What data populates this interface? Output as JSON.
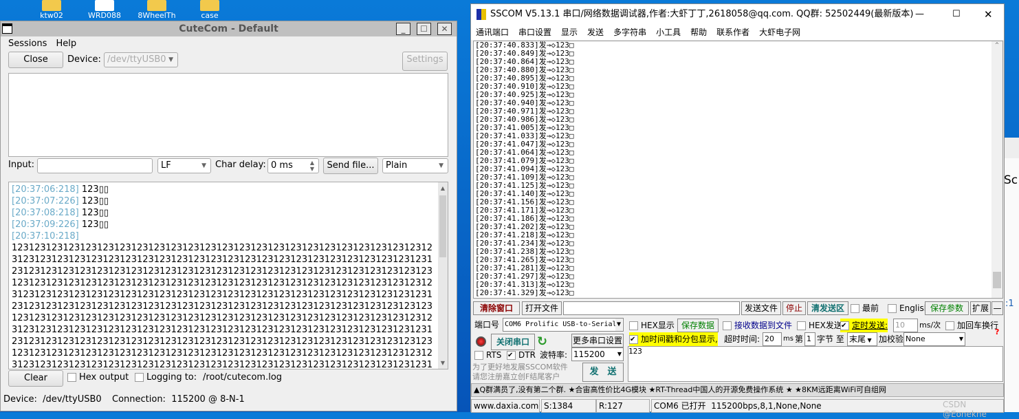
{
  "desktop": {
    "icons": [
      "ktw02",
      "WRD088",
      "8WheelTh",
      "case"
    ],
    "right_app_text": "Sc",
    "right_app_text2": ":1"
  },
  "cutecom": {
    "title": "CuteCom - Default",
    "menu": [
      "Sessions",
      "Help"
    ],
    "close_label": "Close",
    "device_label": "Device:",
    "device_value": "/dev/ttyUSB0",
    "settings_label": "Settings",
    "input_label": "Input:",
    "input_value": "",
    "line_end": "LF",
    "char_delay_label": "Char delay:",
    "char_delay_value": "0 ms",
    "send_file_label": "Send file...",
    "format": "Plain",
    "log": [
      {
        "ts": "[20:37:06:218]",
        "text": "123▯▯"
      },
      {
        "ts": "[20:37:07:226]",
        "text": "123▯▯"
      },
      {
        "ts": "[20:37:08:218]",
        "text": "123▯▯"
      },
      {
        "ts": "[20:37:09:226]",
        "text": "123▯▯"
      },
      {
        "ts": "[20:37:10:218]",
        "text": ""
      }
    ],
    "stream": "123123123123123123123123123123123123123123123123123123123123123123123123123123123123123123123123123123123123123123123123123123123123123123123123123123123123123123123123123123123123123123123123123123123123123123123123123123123123123123123123123123123123123123123123123123123123123123123123123123123123123123123123123123123123123123123123123123123123123123123123123123123123123123123123123123123123123123123123123123123123123123123123123123123123123123123123123123123123123123123123123123123123123123123123123123123123123123123123123123123123123123123123123123123123123123123123123123123123123123123123123123123123123123123123123123123123123123123123123123123123123123123123123123123123123123123123123123123123123123123123123123123123123123123123123123123123123123123123123123123123123123123123123123123123123123123123123123123123123123123123123123123123123123",
    "clear_label": "Clear",
    "hex_output_label": "Hex output",
    "logging_label": "Logging to:",
    "log_path": "/root/cutecom.log",
    "status_device": "Device:  /dev/ttyUSB0",
    "status_connection": "Connection:  115200 @ 8-N-1"
  },
  "sscom": {
    "title": "SSCOM V5.13.1 串口/网络数据调试器,作者:大虾丁丁,2618058@qq.com. QQ群: 52502449(最新版本)",
    "menu": [
      "通讯端口",
      "串口设置",
      "显示",
      "发送",
      "多字符串",
      "小工具",
      "帮助",
      "联系作者",
      "大虾电子网"
    ],
    "log_suffix": "发→◇123□",
    "log_ts": [
      "[20:37:40.833]",
      "[20:37:40.849]",
      "[20:37:40.864]",
      "[20:37:40.880]",
      "[20:37:40.895]",
      "[20:37:40.910]",
      "[20:37:40.925]",
      "[20:37:40.940]",
      "[20:37:40.971]",
      "[20:37:40.986]",
      "[20:37:41.005]",
      "[20:37:41.033]",
      "[20:37:41.047]",
      "[20:37:41.064]",
      "[20:37:41.079]",
      "[20:37:41.094]",
      "[20:37:41.109]",
      "[20:37:41.125]",
      "[20:37:41.140]",
      "[20:37:41.156]",
      "[20:37:41.171]",
      "[20:37:41.186]",
      "[20:37:41.202]",
      "[20:37:41.218]",
      "[20:37:41.234]",
      "[20:37:41.238]",
      "[20:37:41.265]",
      "[20:37:41.281]",
      "[20:37:41.297]",
      "[20:37:41.313]",
      "[20:37:41.329]"
    ],
    "clear_window": "清除窗口",
    "open_file": "打开文件",
    "file_path": "",
    "send_file": "发送文件",
    "stop": "停止",
    "clear_send": "清发送区",
    "topmost": "最前",
    "english": "English",
    "save_params": "保存参数",
    "expand": "扩展",
    "collapse": "—",
    "port_label": "端口号",
    "port_value": "COM6 Prolific USB-to-Serial",
    "hex_display": "HEX显示",
    "save_data": "保存数据",
    "recv_to_file": "接收数据到文件",
    "hex_send": "HEX发送",
    "timed_send": "定时发送:",
    "interval": "10",
    "interval_unit": "ms/次",
    "add_crlf": "加回车换行",
    "close_port": "关闭串口",
    "more_settings": "更多串口设置",
    "timestamp_label": "加时间戳和分包显示,",
    "timeout_label": "超时时间:",
    "timeout_value": "20",
    "timeout_unit": "ms",
    "byte_from_label": "第",
    "byte_from": "1",
    "byte_label": "字节 至",
    "byte_to": "末尾",
    "checksum_label": "加校验",
    "checksum_value": "None",
    "rts": "RTS",
    "dtr": "DTR",
    "baud_label": "波特率:",
    "baud_value": "115200",
    "send_text": "123",
    "promo1": "为了更好地发展SSCOM软件",
    "promo2": "请您注册嘉立创F结尾客户",
    "send_button": "发　送",
    "marquee": "▲Q群满员了,没有第二个群. ★合宙高性价比4G模块 ★RT-Thread中国人的开源免费操作系统 ★ ★8KM远距离WiFi可自组网",
    "status_site": "www.daxia.com",
    "status_sent": "S:1384",
    "status_recv": "R:127",
    "status_port": "COM6 已打开  115200bps,8,1,None,None",
    "watermark": "CSDN @Eonekne",
    "checked": {
      "dtr": true,
      "rts": false,
      "timestamp": true,
      "timed_send": true,
      "hex_display": false,
      "hex_send": false
    }
  }
}
